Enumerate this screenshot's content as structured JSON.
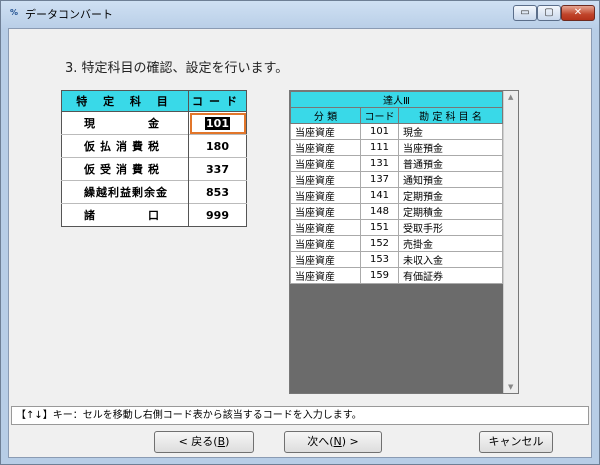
{
  "window": {
    "title": "データコンバート",
    "icon": "app-icon",
    "min": "▭",
    "max": "▢",
    "close": "✕"
  },
  "heading": "3. 特定科目の確認、設定を行います。",
  "left_table": {
    "headers": [
      "特 定 科 目",
      "コード"
    ],
    "rows": [
      {
        "name": "現　　　金",
        "code": "101"
      },
      {
        "name": "仮払消費税",
        "code": "180"
      },
      {
        "name": "仮受消費税",
        "code": "337"
      },
      {
        "name": "繰越利益剰余金",
        "code": "853"
      },
      {
        "name": "諸　　　口",
        "code": "999"
      }
    ]
  },
  "right_table": {
    "title": "達人Ⅲ",
    "headers": [
      "分 類",
      "コード",
      "勘 定 科 目 名"
    ],
    "rows": [
      {
        "category": "当座資産",
        "code": "101",
        "name": "現金"
      },
      {
        "category": "当座資産",
        "code": "111",
        "name": "当座預金"
      },
      {
        "category": "当座資産",
        "code": "131",
        "name": "普通預金"
      },
      {
        "category": "当座資産",
        "code": "137",
        "name": "通知預金"
      },
      {
        "category": "当座資産",
        "code": "141",
        "name": "定期預金"
      },
      {
        "category": "当座資産",
        "code": "148",
        "name": "定期積金"
      },
      {
        "category": "当座資産",
        "code": "151",
        "name": "受取手形"
      },
      {
        "category": "当座資産",
        "code": "152",
        "name": "売掛金"
      },
      {
        "category": "当座資産",
        "code": "153",
        "name": "未収入金"
      },
      {
        "category": "当座資産",
        "code": "159",
        "name": "有価証券"
      }
    ]
  },
  "status": "【↑↓】キー：セルを移動し右側コード表から該当するコードを入力します。",
  "buttons": {
    "back_pre": "< 戻る(",
    "back_key": "B",
    "back_post": ")",
    "next_pre": "次へ(",
    "next_key": "N",
    "next_post": ") >",
    "cancel": "キャンセル"
  }
}
